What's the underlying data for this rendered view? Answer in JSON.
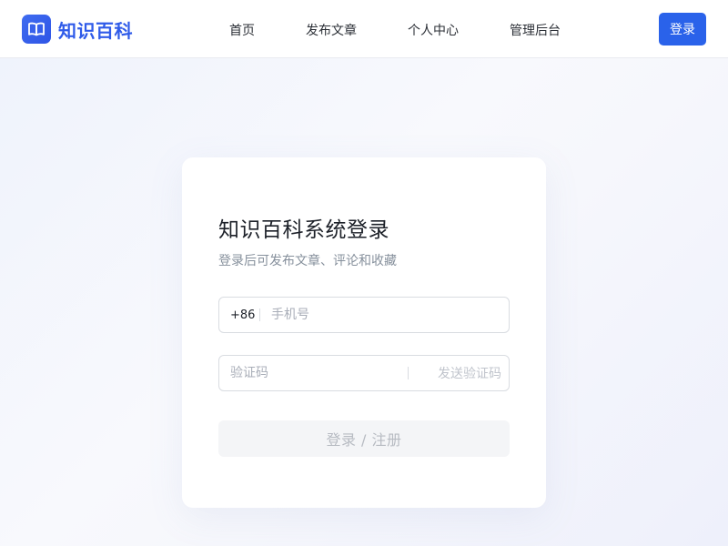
{
  "header": {
    "brand_name": "知识百科",
    "brand_icon": "book-open-icon",
    "nav": [
      {
        "label": "首页"
      },
      {
        "label": "发布文章"
      },
      {
        "label": "个人中心"
      },
      {
        "label": "管理后台"
      }
    ],
    "login_label": "登录"
  },
  "colors": {
    "accent": "#2a62ea",
    "brand_text": "#2f5be9"
  },
  "login_card": {
    "title": "知识百科系统登录",
    "subtitle": "登录后可发布文章、评论和收藏",
    "phone": {
      "prefix": "+86",
      "value": "",
      "placeholder": "手机号"
    },
    "code": {
      "value": "",
      "placeholder": "验证码",
      "send_label": "发送验证码"
    },
    "submit_label": "登录 / 注册"
  }
}
